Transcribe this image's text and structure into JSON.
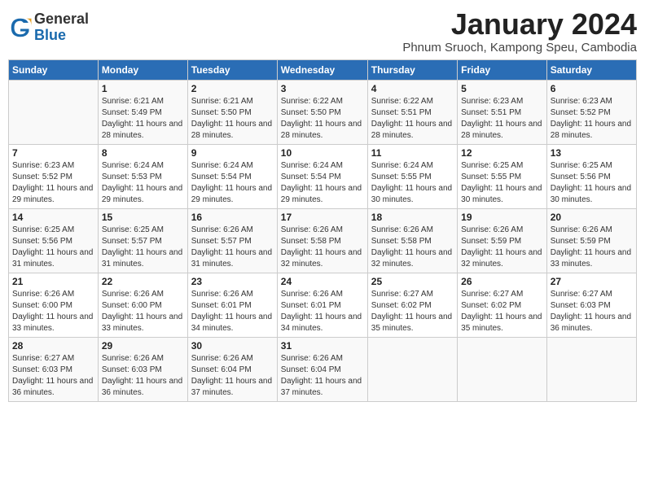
{
  "header": {
    "logo_general": "General",
    "logo_blue": "Blue",
    "month": "January 2024",
    "location": "Phnum Sruoch, Kampong Speu, Cambodia"
  },
  "days_of_week": [
    "Sunday",
    "Monday",
    "Tuesday",
    "Wednesday",
    "Thursday",
    "Friday",
    "Saturday"
  ],
  "weeks": [
    [
      {
        "day": "",
        "sunrise": "",
        "sunset": "",
        "daylight": ""
      },
      {
        "day": "1",
        "sunrise": "6:21 AM",
        "sunset": "5:49 PM",
        "daylight": "11 hours and 28 minutes."
      },
      {
        "day": "2",
        "sunrise": "6:21 AM",
        "sunset": "5:50 PM",
        "daylight": "11 hours and 28 minutes."
      },
      {
        "day": "3",
        "sunrise": "6:22 AM",
        "sunset": "5:50 PM",
        "daylight": "11 hours and 28 minutes."
      },
      {
        "day": "4",
        "sunrise": "6:22 AM",
        "sunset": "5:51 PM",
        "daylight": "11 hours and 28 minutes."
      },
      {
        "day": "5",
        "sunrise": "6:23 AM",
        "sunset": "5:51 PM",
        "daylight": "11 hours and 28 minutes."
      },
      {
        "day": "6",
        "sunrise": "6:23 AM",
        "sunset": "5:52 PM",
        "daylight": "11 hours and 28 minutes."
      }
    ],
    [
      {
        "day": "7",
        "sunrise": "6:23 AM",
        "sunset": "5:52 PM",
        "daylight": "11 hours and 29 minutes."
      },
      {
        "day": "8",
        "sunrise": "6:24 AM",
        "sunset": "5:53 PM",
        "daylight": "11 hours and 29 minutes."
      },
      {
        "day": "9",
        "sunrise": "6:24 AM",
        "sunset": "5:54 PM",
        "daylight": "11 hours and 29 minutes."
      },
      {
        "day": "10",
        "sunrise": "6:24 AM",
        "sunset": "5:54 PM",
        "daylight": "11 hours and 29 minutes."
      },
      {
        "day": "11",
        "sunrise": "6:24 AM",
        "sunset": "5:55 PM",
        "daylight": "11 hours and 30 minutes."
      },
      {
        "day": "12",
        "sunrise": "6:25 AM",
        "sunset": "5:55 PM",
        "daylight": "11 hours and 30 minutes."
      },
      {
        "day": "13",
        "sunrise": "6:25 AM",
        "sunset": "5:56 PM",
        "daylight": "11 hours and 30 minutes."
      }
    ],
    [
      {
        "day": "14",
        "sunrise": "6:25 AM",
        "sunset": "5:56 PM",
        "daylight": "11 hours and 31 minutes."
      },
      {
        "day": "15",
        "sunrise": "6:25 AM",
        "sunset": "5:57 PM",
        "daylight": "11 hours and 31 minutes."
      },
      {
        "day": "16",
        "sunrise": "6:26 AM",
        "sunset": "5:57 PM",
        "daylight": "11 hours and 31 minutes."
      },
      {
        "day": "17",
        "sunrise": "6:26 AM",
        "sunset": "5:58 PM",
        "daylight": "11 hours and 32 minutes."
      },
      {
        "day": "18",
        "sunrise": "6:26 AM",
        "sunset": "5:58 PM",
        "daylight": "11 hours and 32 minutes."
      },
      {
        "day": "19",
        "sunrise": "6:26 AM",
        "sunset": "5:59 PM",
        "daylight": "11 hours and 32 minutes."
      },
      {
        "day": "20",
        "sunrise": "6:26 AM",
        "sunset": "5:59 PM",
        "daylight": "11 hours and 33 minutes."
      }
    ],
    [
      {
        "day": "21",
        "sunrise": "6:26 AM",
        "sunset": "6:00 PM",
        "daylight": "11 hours and 33 minutes."
      },
      {
        "day": "22",
        "sunrise": "6:26 AM",
        "sunset": "6:00 PM",
        "daylight": "11 hours and 33 minutes."
      },
      {
        "day": "23",
        "sunrise": "6:26 AM",
        "sunset": "6:01 PM",
        "daylight": "11 hours and 34 minutes."
      },
      {
        "day": "24",
        "sunrise": "6:26 AM",
        "sunset": "6:01 PM",
        "daylight": "11 hours and 34 minutes."
      },
      {
        "day": "25",
        "sunrise": "6:27 AM",
        "sunset": "6:02 PM",
        "daylight": "11 hours and 35 minutes."
      },
      {
        "day": "26",
        "sunrise": "6:27 AM",
        "sunset": "6:02 PM",
        "daylight": "11 hours and 35 minutes."
      },
      {
        "day": "27",
        "sunrise": "6:27 AM",
        "sunset": "6:03 PM",
        "daylight": "11 hours and 36 minutes."
      }
    ],
    [
      {
        "day": "28",
        "sunrise": "6:27 AM",
        "sunset": "6:03 PM",
        "daylight": "11 hours and 36 minutes."
      },
      {
        "day": "29",
        "sunrise": "6:26 AM",
        "sunset": "6:03 PM",
        "daylight": "11 hours and 36 minutes."
      },
      {
        "day": "30",
        "sunrise": "6:26 AM",
        "sunset": "6:04 PM",
        "daylight": "11 hours and 37 minutes."
      },
      {
        "day": "31",
        "sunrise": "6:26 AM",
        "sunset": "6:04 PM",
        "daylight": "11 hours and 37 minutes."
      },
      {
        "day": "",
        "sunrise": "",
        "sunset": "",
        "daylight": ""
      },
      {
        "day": "",
        "sunrise": "",
        "sunset": "",
        "daylight": ""
      },
      {
        "day": "",
        "sunrise": "",
        "sunset": "",
        "daylight": ""
      }
    ]
  ]
}
